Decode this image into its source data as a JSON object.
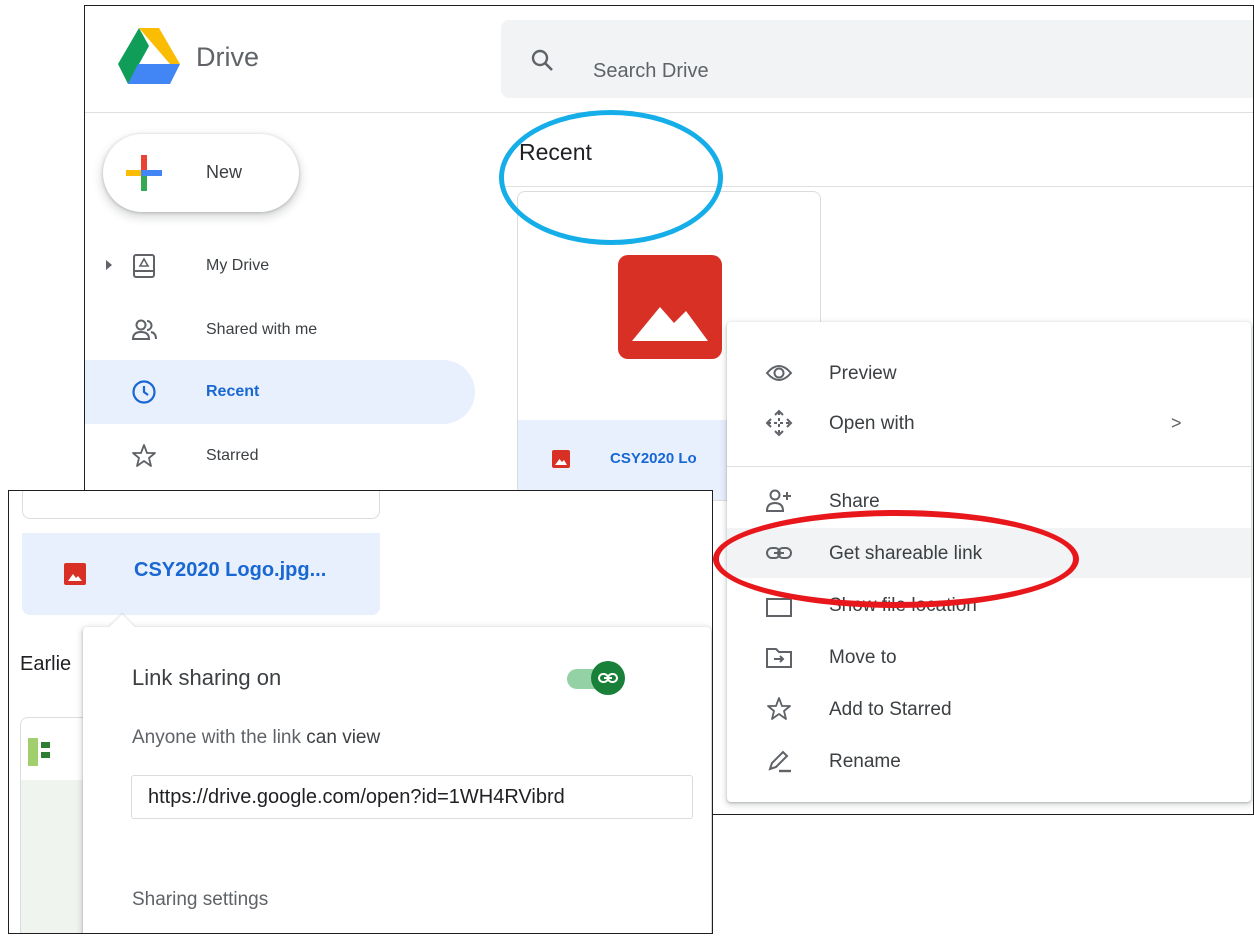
{
  "drive": {
    "app_name": "Drive",
    "search": {
      "placeholder": "Search Drive"
    },
    "new_button": "New",
    "nav": [
      {
        "label": "My Drive",
        "icon": "drive-icon"
      },
      {
        "label": "Shared with me",
        "icon": "people-icon"
      },
      {
        "label": "Recent",
        "icon": "clock-icon",
        "active": true
      },
      {
        "label": "Starred",
        "icon": "star-icon"
      }
    ],
    "section_title": "Recent",
    "file": {
      "name": "CSY2020 Lo",
      "type_icon": "image-file-icon"
    }
  },
  "context_menu": {
    "items": [
      {
        "label": "Preview",
        "icon": "eye-icon"
      },
      {
        "label": "Open with",
        "icon": "move-arrows-icon",
        "submenu": ">"
      },
      {
        "label": "Share",
        "icon": "add-person-icon"
      },
      {
        "label": "Get shareable link",
        "icon": "link-icon",
        "highlighted": true
      },
      {
        "label": "Show file location",
        "icon": "folder-icon"
      },
      {
        "label": "Move to",
        "icon": "move-to-folder-icon"
      },
      {
        "label": "Add to Starred",
        "icon": "star-icon"
      },
      {
        "label": "Rename",
        "icon": "pencil-icon"
      }
    ]
  },
  "share_popup": {
    "file_name": "CSY2020 Logo.jpg...",
    "earlier_label": "Earlie",
    "link_status": "Link sharing on",
    "toggle_on": true,
    "access_prefix": "Anyone with the link",
    "access_role": "can view",
    "link_url": "https://drive.google.com/open?id=1WH4RVibrd",
    "settings_link": "Sharing settings"
  },
  "colors": {
    "accent_blue": "#1967d2",
    "active_nav_bg": "#e8f0fe",
    "file_red": "#d93025",
    "toggle_green": "#188038",
    "annotation_red": "#e8171b",
    "annotation_blue": "#15aee8"
  }
}
